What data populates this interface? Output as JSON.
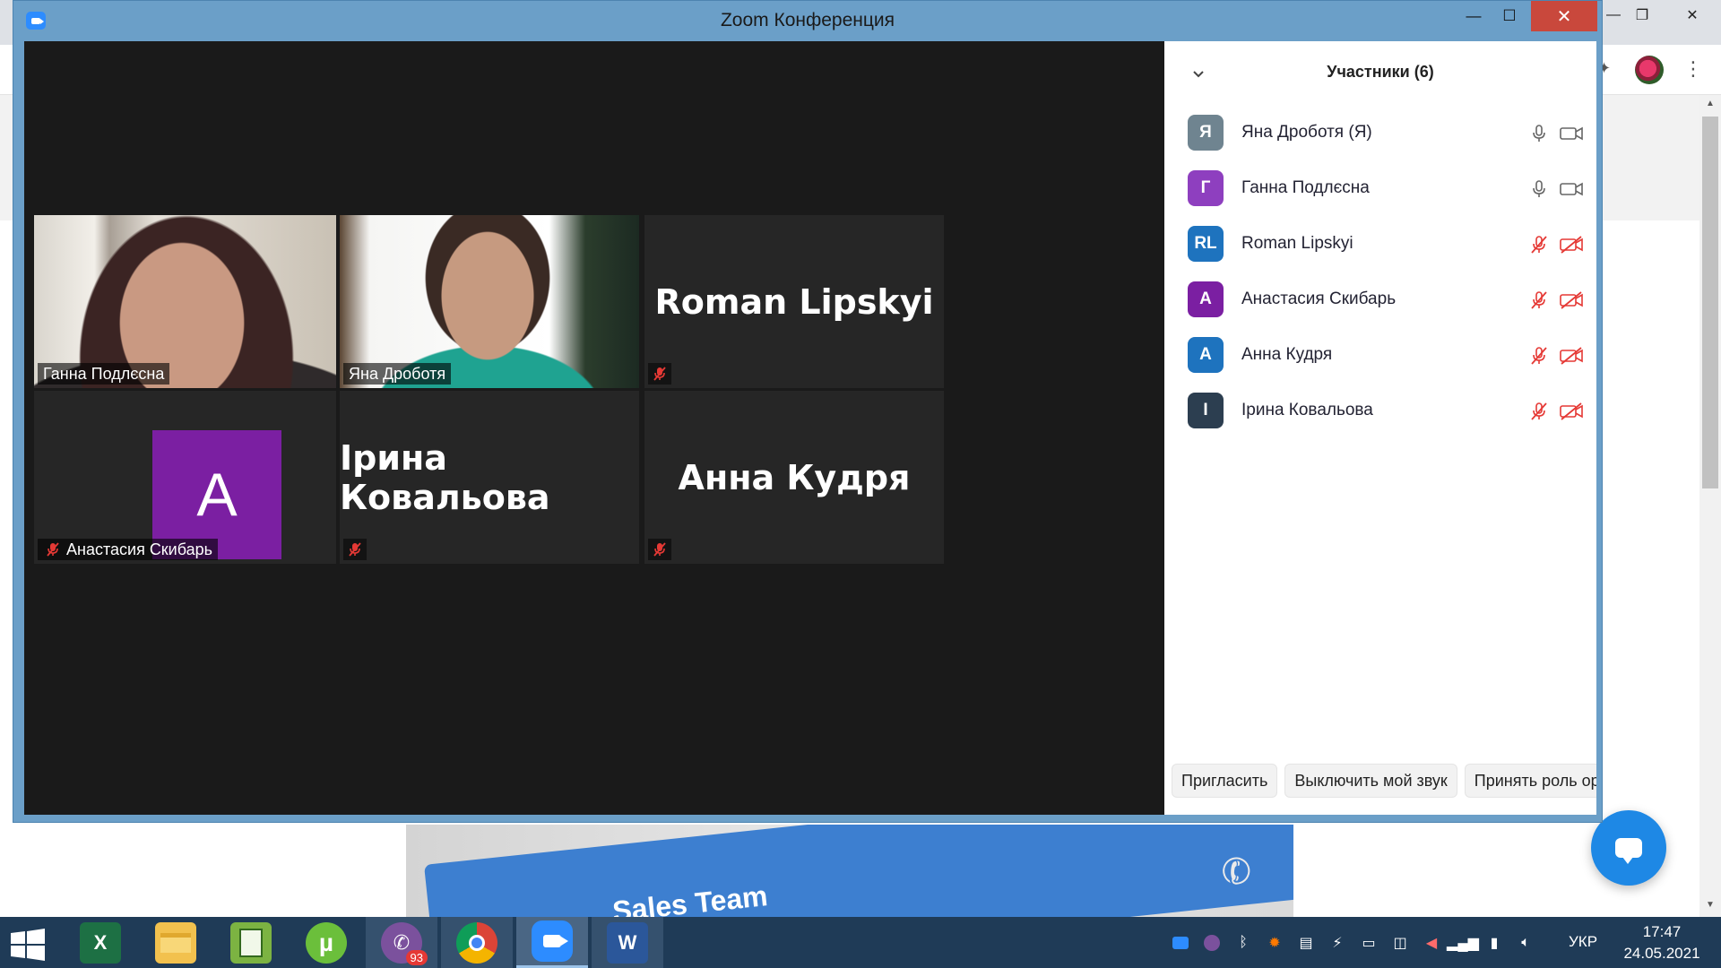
{
  "window": {
    "title": "Zoom Конференция",
    "minimize": "—",
    "maximize": "☐",
    "close": "✕"
  },
  "gallery": {
    "tiles": [
      {
        "name": "Ганна Подлєсна",
        "type": "video",
        "active": true,
        "muted": false
      },
      {
        "name": "Яна Дроботя",
        "type": "video",
        "active": false,
        "muted": false
      },
      {
        "name": "Roman Lipskyi",
        "type": "name",
        "active": false,
        "muted": true
      },
      {
        "name": "Анастасия Скибарь",
        "type": "avatar",
        "avatar_letter": "A",
        "active": false,
        "muted": true
      },
      {
        "name": "Ірина Ковальова",
        "type": "name",
        "active": false,
        "muted": true
      },
      {
        "name": "Анна Кудря",
        "type": "name",
        "active": false,
        "muted": true
      }
    ]
  },
  "participants_panel": {
    "title": "Участники (6)",
    "participants": [
      {
        "initials": "Я",
        "name": "Яна Дроботя (Я)",
        "color": "#6f8490",
        "mic": "on",
        "cam": "on"
      },
      {
        "initials": "Г",
        "name": "Ганна Подлєсна",
        "color": "#8e3fbf",
        "mic": "on",
        "cam": "on"
      },
      {
        "initials": "RL",
        "name": "Roman Lipskyi",
        "color": "#1e73be",
        "mic": "muted",
        "cam": "off"
      },
      {
        "initials": "A",
        "name": "Анастасия Скибарь",
        "color": "#7b1fa2",
        "mic": "muted",
        "cam": "off"
      },
      {
        "initials": "A",
        "name": "Анна Кудря",
        "color": "#1e73be",
        "mic": "muted",
        "cam": "off"
      },
      {
        "initials": "I",
        "name": "Ірина Ковальова",
        "color": "#2c3e50",
        "mic": "muted",
        "cam": "off"
      }
    ],
    "buttons": {
      "invite": "Пригласить",
      "mute_me": "Выключить мой звук",
      "claim_host": "Принять роль орга"
    }
  },
  "background": {
    "banner_text": "Sales Team"
  },
  "taskbar": {
    "apps": [
      {
        "icon": "excel-icon",
        "label": "X"
      },
      {
        "icon": "file-explorer-icon",
        "label": ""
      },
      {
        "icon": "notepad-icon",
        "label": ""
      },
      {
        "icon": "utorrent-icon",
        "label": "µ"
      },
      {
        "icon": "viber-icon",
        "label": "",
        "badge": "93"
      },
      {
        "icon": "chrome-icon",
        "label": ""
      },
      {
        "icon": "zoom-icon",
        "label": ""
      },
      {
        "icon": "word-icon",
        "label": "W"
      }
    ],
    "language": "УКР",
    "time": "17:47",
    "date": "24.05.2021"
  },
  "colors": {
    "zoom_frame": "#6b9fc8",
    "active_speaker": "#d9ec5a",
    "muted_red": "#e53935",
    "taskbar": "#1f3b57"
  }
}
